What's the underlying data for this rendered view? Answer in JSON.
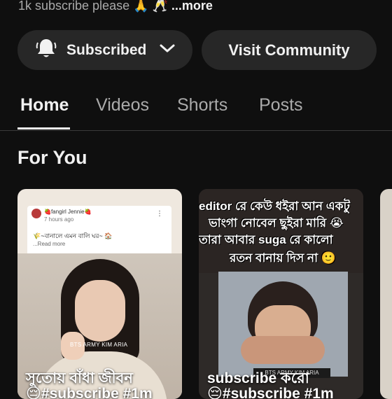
{
  "description": {
    "text": "1k subscribe please 🙏 🥂 ",
    "more_label": "...more"
  },
  "actions": {
    "subscribed_label": "Subscribed",
    "visit_community_label": "Visit Community"
  },
  "tabs": [
    {
      "label": "Home",
      "active": true
    },
    {
      "label": "Videos",
      "active": false
    },
    {
      "label": "Shorts",
      "active": false
    },
    {
      "label": "Posts",
      "active": false
    }
  ],
  "section": {
    "title": "For You"
  },
  "cards": [
    {
      "post_user": "🍓fangirl Jennie🍓",
      "post_time": "7 hours ago",
      "post_text": "🌾~বানালে এমন বালি ঘর~ 🏠",
      "post_more": "...Read more",
      "watermark": "BTS ARMY KIM ARIA",
      "caption": "সুতোয় বাঁধা জীবন",
      "caption_second": "😔#subscribe #1m"
    },
    {
      "meme_lines": [
        "editor রে কেউ ধইরা আন একটু",
        "ভাংগা নোবেল ছুইরা মারি 😭",
        "তারা আবার suga রে কালো",
        "রতন বানায় দিস না 🙂"
      ],
      "meme_tag": "BTS ARMY KIM ARIA",
      "caption": "subscribe করো",
      "caption_second": "😔#subscribe #1m"
    }
  ],
  "colors": {
    "background": "#0f0f0f",
    "pill": "#272727",
    "text_primary": "#f1f1f1",
    "text_secondary": "#aaaaaa"
  },
  "icons": {
    "bell": "bell-icon",
    "chevron": "chevron-down-icon"
  }
}
